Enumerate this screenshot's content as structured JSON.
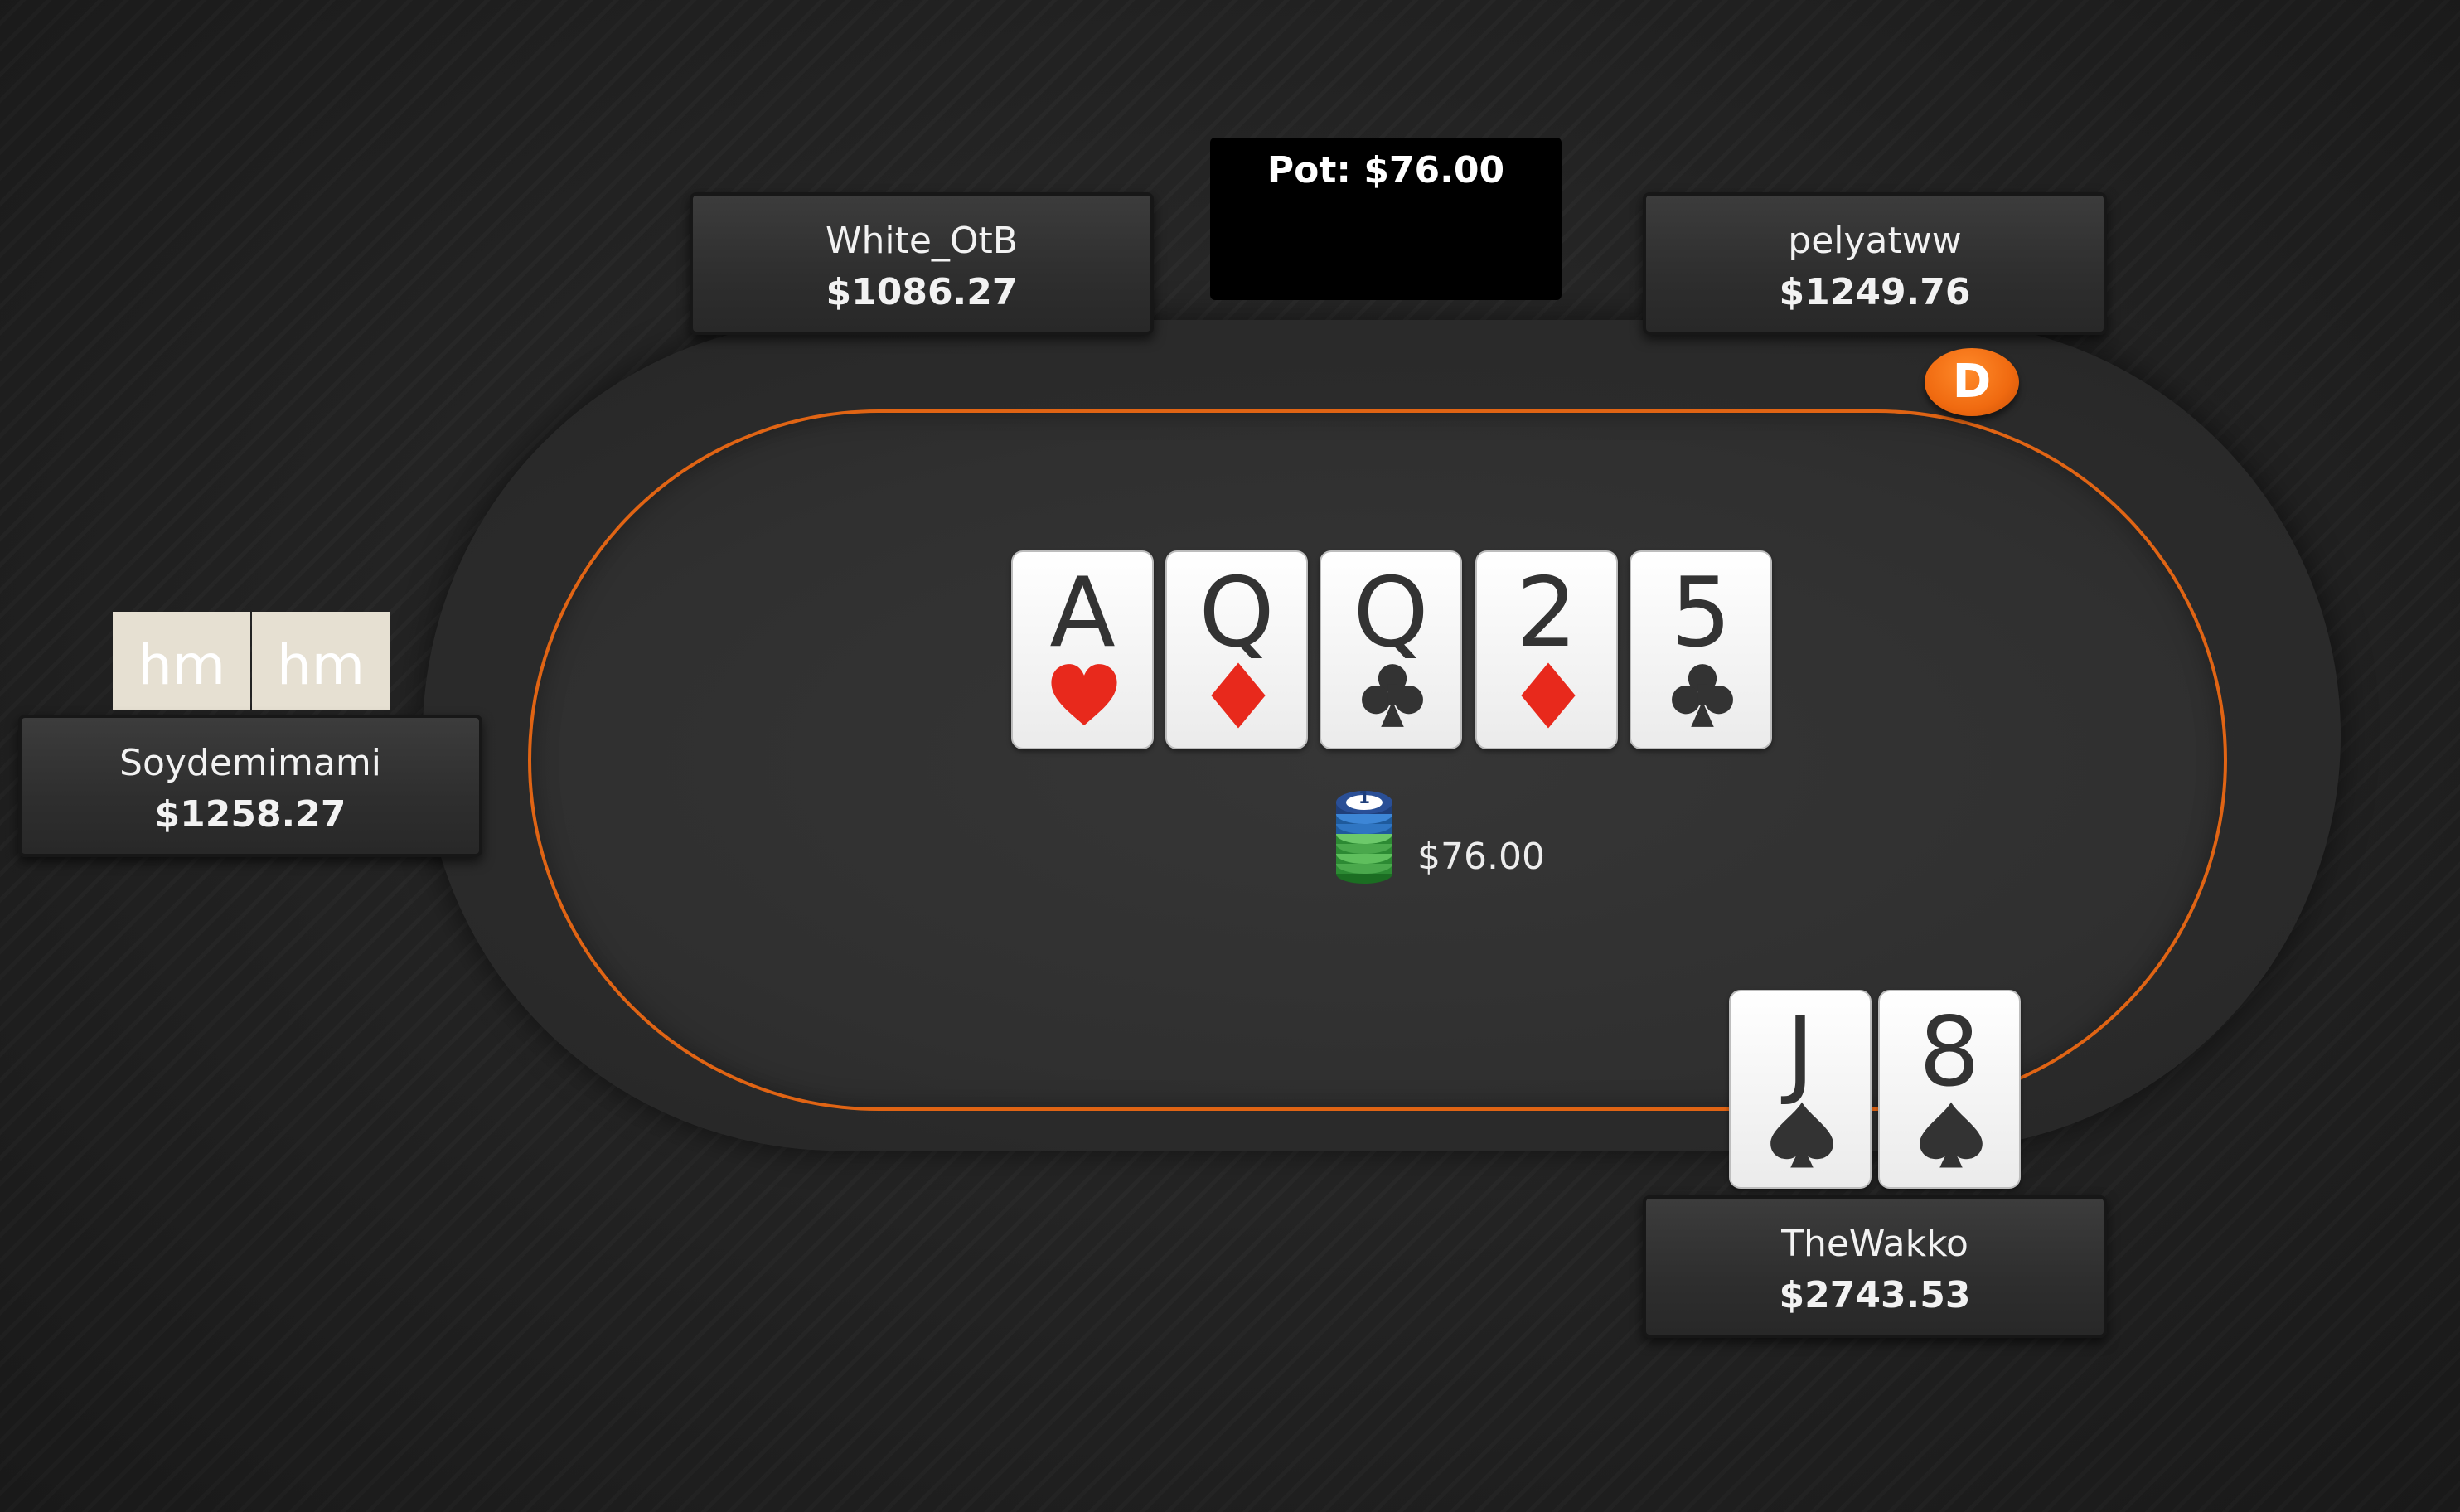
{
  "pot": {
    "label": "Pot: $76.00"
  },
  "center_pot": {
    "amount": "$76.00",
    "chip_top_value": "1"
  },
  "dealer_button": {
    "label": "D"
  },
  "board": {
    "cards": [
      {
        "rank": "A",
        "suit": "hearts",
        "color": "#e8291c"
      },
      {
        "rank": "Q",
        "suit": "diamonds",
        "color": "#e8291c"
      },
      {
        "rank": "Q",
        "suit": "clubs",
        "color": "#333333"
      },
      {
        "rank": "2",
        "suit": "diamonds",
        "color": "#e8291c"
      },
      {
        "rank": "5",
        "suit": "clubs",
        "color": "#333333"
      }
    ]
  },
  "players": [
    {
      "name": "White_OtB",
      "stack": "$1086.27"
    },
    {
      "name": "pelyatww",
      "stack": "$1249.76"
    },
    {
      "name": "Soydemimami",
      "stack": "$1258.27",
      "hole_cards": [
        "hm",
        "hm"
      ]
    },
    {
      "name": "TheWakko",
      "stack": "$2743.53",
      "hole_cards": [
        {
          "rank": "J",
          "suit": "spades",
          "color": "#333333"
        },
        {
          "rank": "8",
          "suit": "spades",
          "color": "#333333"
        }
      ]
    }
  ],
  "colors": {
    "felt_border": "#e06414",
    "dealer": "#f06a10",
    "red_suit": "#e8291c",
    "black_suit": "#333333"
  }
}
